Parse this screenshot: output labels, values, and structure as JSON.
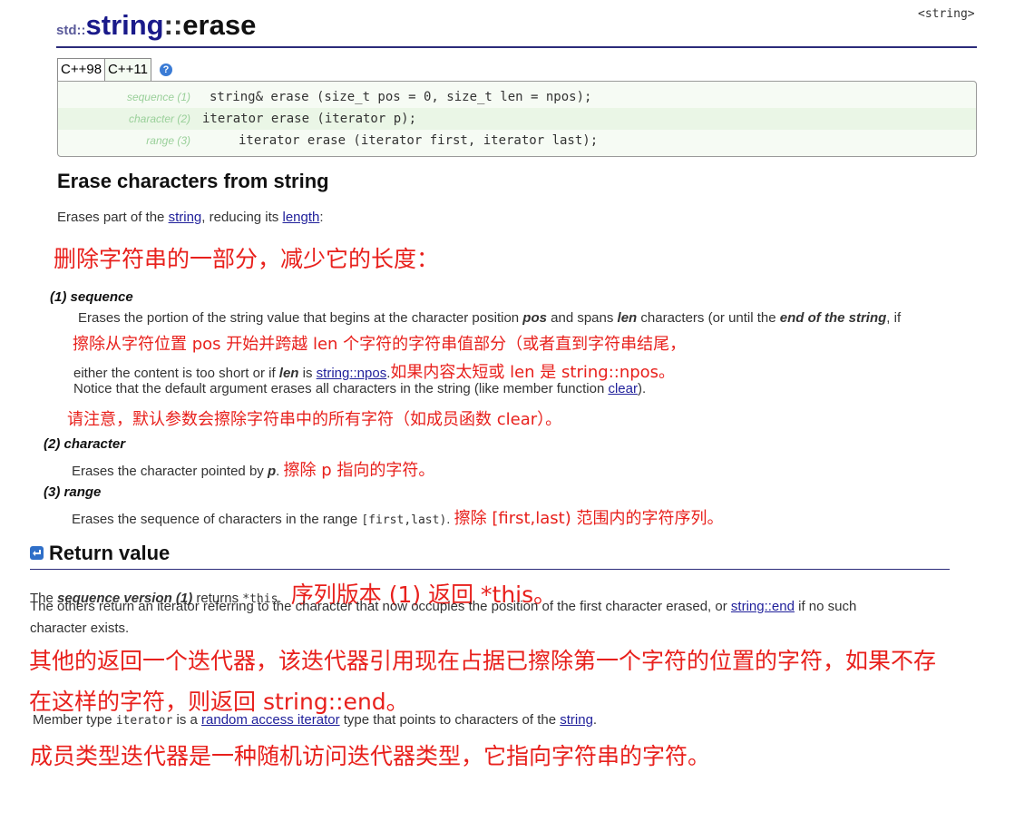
{
  "header": {
    "prefix": "std::",
    "class_name": "string",
    "separator": "::",
    "member": "erase",
    "header_file": "<string>"
  },
  "tabs": [
    {
      "label": "C++98",
      "active": true
    },
    {
      "label": "C++11",
      "active": false
    }
  ],
  "help_icon": "?",
  "prototypes": [
    {
      "label": "sequence (1)",
      "code": "string& erase (size_t pos = 0, size_t len = npos);"
    },
    {
      "label": "character (2)",
      "code": "iterator erase (iterator p);"
    },
    {
      "label": "range (3)",
      "code": "iterator erase (iterator first, iterator last);"
    }
  ],
  "title": "Erase characters from string",
  "intro": {
    "t1": "Erases part of the ",
    "link1": "string",
    "t2": ", reducing its ",
    "link2": "length",
    "t3": ":"
  },
  "notes": {
    "intro": "删除字符串的一部分，减少它的长度：",
    "seq_1": "擦除从字符位置 pos 开始并跨越 len 个字符的字符串值部分（或者直到字符串结尾，",
    "seq_2": "如果内容太短或 len 是 string::npos。",
    "seq_3": "请注意，默认参数会擦除字符串中的所有字符（如成员函数 clear）。",
    "char": "擦除 p 指向的字符。",
    "range": "擦除 [first,last) 范围内的字符序列。",
    "ret_1": "序列版本 (1) 返回 *this。",
    "ret_2a": "其他的返回一个迭代器，该迭代器引用现在占据已擦除第一个字符的位置的字符，如果不存",
    "ret_2b": "在这样的字符，则返回 string::end。",
    "member_type": "成员类型迭代器是一种随机访问迭代器类型，它指向字符串的字符。"
  },
  "sequence": {
    "heading_num": "(1)",
    "heading": "sequence",
    "l1_a": "Erases the portion of the string value that begins at the character position ",
    "l1_pos": "pos",
    "l1_b": " and spans ",
    "l1_len": "len",
    "l1_c": " characters (or until the ",
    "l1_end": "end of the string",
    "l1_d": ", if",
    "l2_a": "either the content is too short or if ",
    "l2_len": "len",
    "l2_b": " is ",
    "l2_link": "string::npos",
    "l2_c": ".",
    "l3_a": "Notice that the default argument erases all characters in the string (like member function ",
    "l3_link": "clear",
    "l3_b": ")."
  },
  "character": {
    "heading_num": "(2)",
    "heading": "character",
    "a": "Erases the character pointed by ",
    "p": "p",
    "b": "."
  },
  "range": {
    "heading_num": "(3)",
    "heading": "range",
    "a": "Erases the sequence of characters in the range ",
    "code": "[first,last)",
    "b": "."
  },
  "return_value": {
    "heading": "Return value",
    "l1_a": "The ",
    "l1_bold": "sequence version (1)",
    "l1_b": " returns ",
    "l1_code": "*this",
    "l1_c": ".",
    "l2_a": "The others return an iterator referring to the character that now occupies the position of the first character erased, or ",
    "l2_link": "string::end",
    "l2_b": " if no such",
    "l3": "character exists.",
    "mt_a": "Member type ",
    "mt_code": "iterator",
    "mt_b": " is a ",
    "mt_link1": "random access iterator",
    "mt_c": " type that points to characters of the ",
    "mt_link2": "string",
    "mt_d": "."
  }
}
